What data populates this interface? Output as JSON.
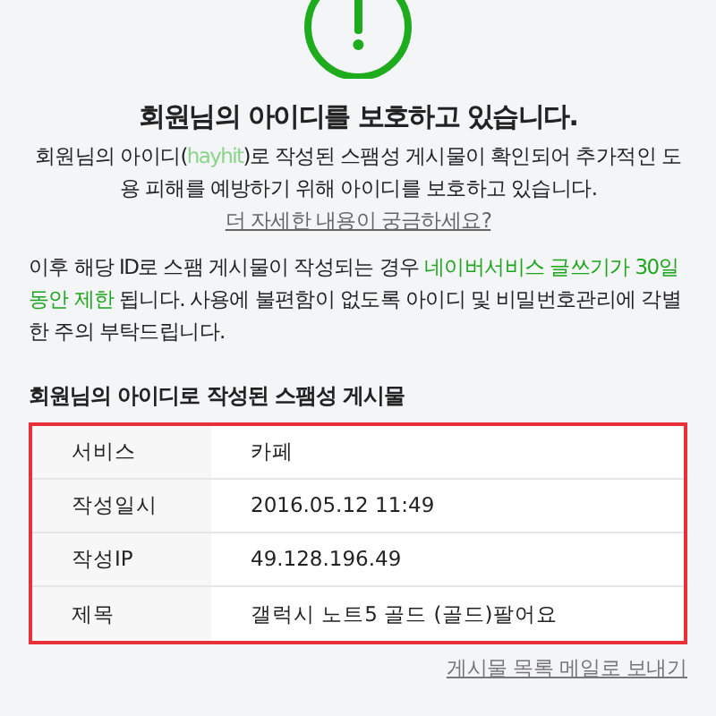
{
  "title": "회원님의 아이디를 보호하고 있습니다.",
  "intro": [
    {
      "kind": "text",
      "text": "회원님의 아이디("
    },
    {
      "kind": "highlight",
      "text": "hayhit"
    },
    {
      "kind": "text",
      "text": ")로 작성된 스팸성 게시물이 확인되어 추가적인 도용 피해를 예방하기 위해 아이디를 보호하고 있습니다. "
    },
    {
      "kind": "link",
      "text": "더 자세한 내용이 궁금하세요?"
    }
  ],
  "notice": [
    {
      "kind": "text",
      "text": "이후 해당 ID로 스팸 게시물이 작성되는 경우 "
    },
    {
      "kind": "highlight",
      "text": "네이버서비스 글쓰기가 30일 동안 제한"
    },
    {
      "kind": "text",
      "text": " 됩니다. 사용에 불편함이 없도록 아이디 및 비밀번호관리에 각별한 주의 부탁드립니다."
    }
  ],
  "section_title": "회원님의 아이디로 작성된 스팸성 게시물",
  "table": {
    "rows": [
      {
        "label": "서비스",
        "value": "카페"
      },
      {
        "label": "작성일시",
        "value": "2016.05.12 11:49"
      },
      {
        "label": "작성IP",
        "value": "49.128.196.49"
      },
      {
        "label": "제목",
        "value": "갤럭시 노트5 골드 (골드)팔어요"
      }
    ]
  },
  "footer_link": "게시물 목록 메일로 보내기"
}
